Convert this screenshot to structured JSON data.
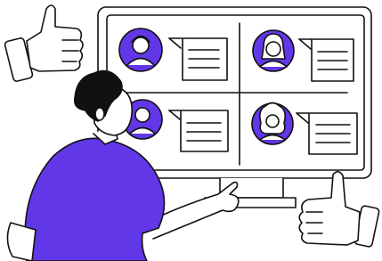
{
  "illustration": {
    "colors": {
      "accent": "#6237e8",
      "outline": "#111111",
      "background": "#ffffff",
      "hair": "#111111",
      "skin": "#ffffff"
    },
    "icons": [
      "thumbs-up-icon",
      "chat-bubble-icon",
      "user-avatar-icon",
      "monitor-icon"
    ]
  }
}
